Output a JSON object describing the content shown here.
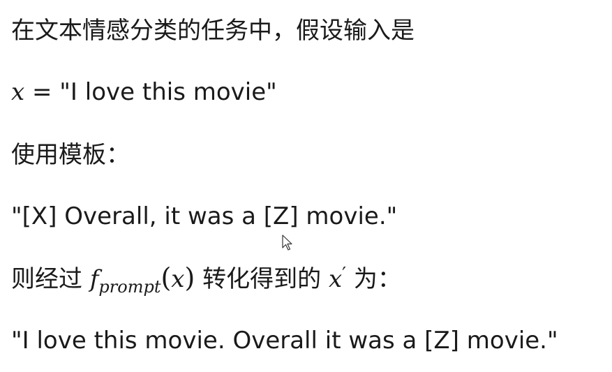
{
  "line1": "在文本情感分类的任务中，假设输入是",
  "line2": {
    "var": "x",
    "eq": " = ",
    "text": "\"I love this movie\""
  },
  "line3": "使用模板：",
  "line4": "\"[X] Overall, it was a [Z] movie.\"",
  "line5": {
    "prefix": "则经过 ",
    "func": "f",
    "sub": "prompt",
    "lparen": "(",
    "arg": "x",
    "rparen": ")",
    "middle": " 转化得到的 ",
    "var": "x",
    "prime": "′",
    "suffix": " 为："
  },
  "line6": "\"I love this movie. Overall it was a [Z] movie.\""
}
